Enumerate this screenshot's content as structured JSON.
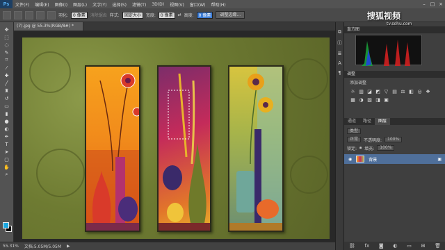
{
  "app": {
    "logo": "Ps"
  },
  "menu": [
    "文件(F)",
    "编辑(E)",
    "图像(I)",
    "图层(L)",
    "文字(Y)",
    "选择(S)",
    "滤镜(T)",
    "3D(D)",
    "视图(V)",
    "窗口(W)",
    "帮助(H)"
  ],
  "window_controls": [
    "–",
    "□",
    "×"
  ],
  "options": {
    "feather_label": "羽化:",
    "feather_value": "0 像素",
    "antialias_label": "消除锯齿",
    "style_label": "样式:",
    "style_value": "固定大小",
    "width_label": "宽度:",
    "width_value": "0 像素",
    "height_label": "高度:",
    "height_value": "0 像素",
    "refine_edge_label": "调整边缘..."
  },
  "document": {
    "tab_title": "(7).jpg @ 55.3%(RGB/8#) *"
  },
  "status": {
    "zoom": "55.31%",
    "doc_size": "文档:5.05M/5.05M"
  },
  "dock": {
    "histogram_title": "直方图",
    "adjustments_title": "调整",
    "add_adjustment_label": "添加调整",
    "layer_tabs": [
      "通道",
      "路径",
      "图层"
    ],
    "layer_kind_label": "类型",
    "blend_mode": "正常",
    "opacity_label": "不透明度:",
    "opacity_value": "100%",
    "lock_label": "锁定:",
    "fill_label": "填充:",
    "fill_value": "100%",
    "layer_name": "背景",
    "footer_icons": [
      "link-icon",
      "fx-icon",
      "mask-icon",
      "adjust-icon",
      "folder-icon",
      "new-layer-icon",
      "trash-icon"
    ]
  },
  "watermark": {
    "brand": "搜狐视频",
    "url": "tv.sohu.com"
  },
  "colors": {
    "foreground": "#1aa7e0",
    "background": "#000000",
    "selection_highlight": "#3a7bd5"
  }
}
